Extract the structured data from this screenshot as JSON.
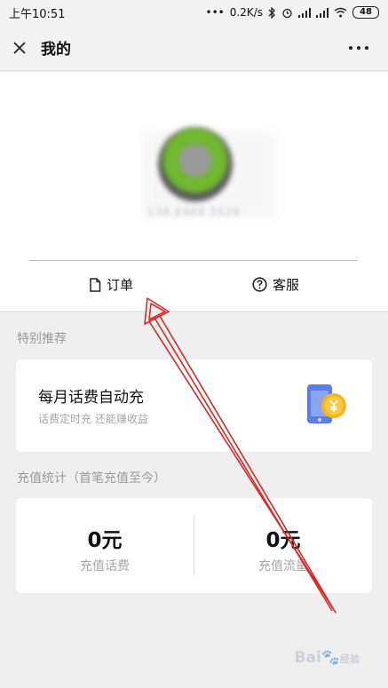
{
  "status_bar": {
    "time": "上午10:51",
    "net_speed": "0.2K/s",
    "battery": "48"
  },
  "nav": {
    "title": "我的",
    "close_icon": "close-icon",
    "more_icon": "more-icon"
  },
  "profile": {
    "phone_masked": "138 6469 5528",
    "actions": [
      {
        "label": "订单",
        "icon": "document-icon"
      },
      {
        "label": "客服",
        "icon": "help-circle-icon"
      }
    ]
  },
  "special": {
    "section_label": "特别推荐",
    "title": "每月话费自动充",
    "subtitle": "话费定时充 还能赚收益",
    "icon": "phone-yuan-icon"
  },
  "stats": {
    "section_label": "充值统计（首笔充值至今）",
    "items": [
      {
        "value": "0元",
        "label": "充值话费"
      },
      {
        "value": "0元",
        "label": "充值流量"
      }
    ]
  },
  "watermark": {
    "text": "Bai",
    "suffix": "经验"
  },
  "colors": {
    "annotation_red": "#d62a2a",
    "card_bg": "#ffffff",
    "page_bg": "#efefef"
  }
}
